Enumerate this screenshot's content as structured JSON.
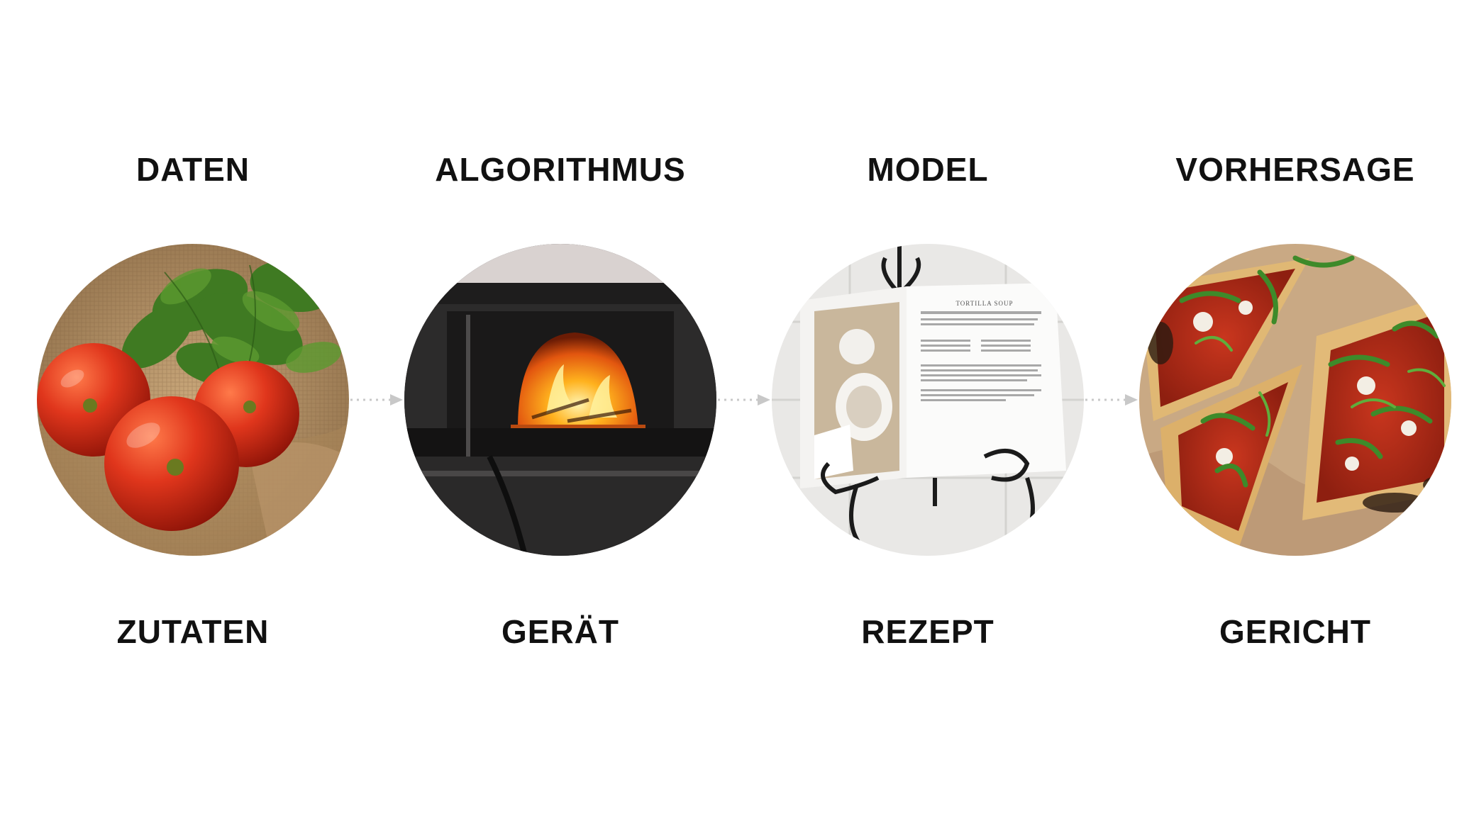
{
  "stages": [
    {
      "title": "DATEN",
      "caption": "ZUTATEN",
      "image": "tomatoes-basil-burlap-photo"
    },
    {
      "title": "ALGORITHMUS",
      "caption": "GERÄT",
      "image": "wood-fired-pizza-oven-photo"
    },
    {
      "title": "MODEL",
      "caption": "REZEPT",
      "image": "open-cookbook-on-stand-photo"
    },
    {
      "title": "VORHERSAGE",
      "caption": "GERICHT",
      "image": "arugula-pizza-slices-photo"
    }
  ],
  "book_page_heading": "TORTILLA SOUP",
  "colors": {
    "text": "#111111",
    "connector": "#c8c8c8",
    "tomato": "#d8311b",
    "basil": "#3f7a22",
    "burlap": "#b9976a",
    "fire": "#f28a1c"
  }
}
